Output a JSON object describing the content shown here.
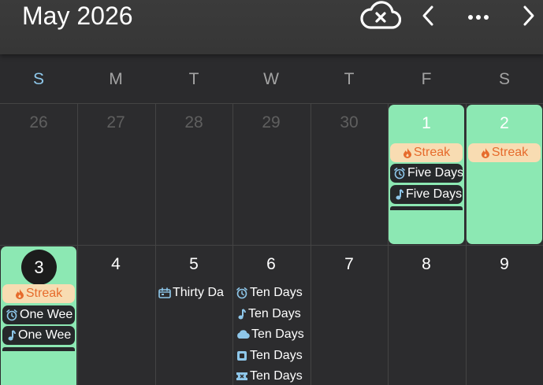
{
  "header": {
    "title": "May 2026",
    "icons": [
      "cloud-off-icon",
      "chevron-left-icon",
      "more-icon",
      "chevron-right-icon"
    ]
  },
  "weekdays": [
    "S",
    "M",
    "T",
    "W",
    "T",
    "F",
    "S"
  ],
  "week1": {
    "days": [
      "26",
      "27",
      "28",
      "29",
      "30",
      "1",
      "2"
    ],
    "d1": {
      "streak": "Streak",
      "events": [
        "Five Days",
        "Five Days"
      ]
    },
    "d2": {
      "streak": "Streak"
    }
  },
  "week2": {
    "days": [
      "3",
      "4",
      "5",
      "6",
      "7",
      "8",
      "9"
    ],
    "d3": {
      "streak": "Streak",
      "events": [
        "One Wee",
        "One Wee"
      ]
    },
    "d5": {
      "events": [
        "Thirty Da"
      ]
    },
    "d6": {
      "events": [
        "Ten Days",
        "Ten Days",
        "Ten Days",
        "Ten Days",
        "Ten Days"
      ]
    }
  },
  "colors": {
    "highlight": "#8ce8b3",
    "streak_bg": "#f8dcb2",
    "streak_text": "#e66b2c",
    "icon_blue": "#8ec7ea",
    "sunday": "#8ec7ea"
  }
}
